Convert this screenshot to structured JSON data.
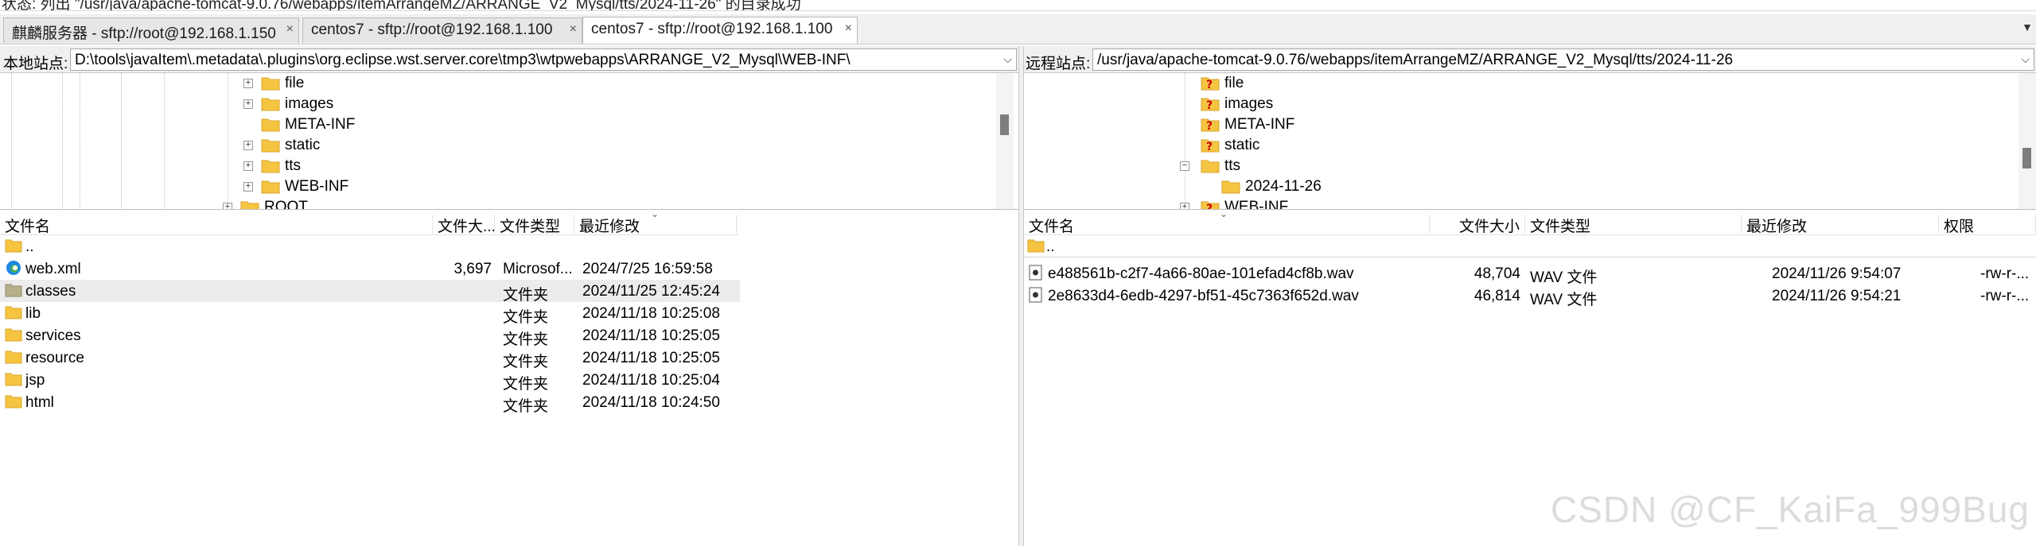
{
  "status_line": "状态: 列出 \"/usr/java/apache-tomcat-9.0.76/webapps/itemArrangeMZ/ARRANGE_V2_Mysql/tts/2024-11-26\" 的目录成功",
  "tabs": [
    {
      "label": "麒麟服务器 - sftp://root@192.168.1.150"
    },
    {
      "label": "centos7 - sftp://root@192.168.1.100"
    },
    {
      "label": "centos7 - sftp://root@192.168.1.100"
    }
  ],
  "local_site": {
    "label": "本地站点:",
    "path": "D:\\tools\\javaItem\\.metadata\\.plugins\\org.eclipse.wst.server.core\\tmp3\\wtpwebapps\\ARRANGE_V2_Mysql\\WEB-INF\\"
  },
  "remote_site": {
    "label": "远程站点:",
    "path": "/usr/java/apache-tomcat-9.0.76/webapps/itemArrangeMZ/ARRANGE_V2_Mysql/tts/2024-11-26"
  },
  "local_tree": [
    {
      "name": "file",
      "expandable": true
    },
    {
      "name": "images",
      "expandable": true
    },
    {
      "name": "META-INF",
      "expandable": false
    },
    {
      "name": "static",
      "expandable": true
    },
    {
      "name": "tts",
      "expandable": true
    },
    {
      "name": "WEB-INF",
      "expandable": true
    },
    {
      "name": "ROOT",
      "expandable": true
    }
  ],
  "remote_tree": [
    {
      "name": "file",
      "unknown": true
    },
    {
      "name": "images",
      "unknown": true
    },
    {
      "name": "META-INF",
      "unknown": true
    },
    {
      "name": "static",
      "unknown": true
    },
    {
      "name": "tts",
      "unknown": false
    },
    {
      "name": "2024-11-26",
      "unknown": false
    },
    {
      "name": "WEB-INF",
      "unknown": true
    }
  ],
  "local_list": {
    "columns": [
      "文件名",
      "文件大...",
      "文件类型",
      "最近修改"
    ],
    "rows": [
      {
        "name": "..",
        "size": "",
        "type": "",
        "modified": "",
        "icon": "folder-up"
      },
      {
        "name": "web.xml",
        "size": "3,697",
        "type": "Microsof...",
        "modified": "2024/7/25 16:59:58",
        "icon": "edge-icon"
      },
      {
        "name": "classes",
        "size": "",
        "type": "文件夹",
        "modified": "2024/11/25 12:45:24",
        "icon": "folder-dark"
      },
      {
        "name": "lib",
        "size": "",
        "type": "文件夹",
        "modified": "2024/11/18 10:25:08",
        "icon": "folder"
      },
      {
        "name": "services",
        "size": "",
        "type": "文件夹",
        "modified": "2024/11/18 10:25:05",
        "icon": "folder"
      },
      {
        "name": "resource",
        "size": "",
        "type": "文件夹",
        "modified": "2024/11/18 10:25:05",
        "icon": "folder"
      },
      {
        "name": "jsp",
        "size": "",
        "type": "文件夹",
        "modified": "2024/11/18 10:25:04",
        "icon": "folder"
      },
      {
        "name": "html",
        "size": "",
        "type": "文件夹",
        "modified": "2024/11/18 10:24:50",
        "icon": "folder"
      }
    ]
  },
  "remote_list": {
    "columns": [
      "文件名",
      "文件大小",
      "文件类型",
      "最近修改",
      "权限"
    ],
    "rows": [
      {
        "name": "..",
        "size": "",
        "type": "",
        "modified": "",
        "perm": "",
        "icon": "folder-up"
      },
      {
        "name": "e488561b-c2f7-4a66-80ae-101efad4cf8b.wav",
        "size": "48,704",
        "type": "WAV 文件",
        "modified": "2024/11/26 9:54:07",
        "perm": "-rw-r-...",
        "icon": "audio-file-icon"
      },
      {
        "name": "2e8633d4-6edb-4297-bf51-45c7363f652d.wav",
        "size": "46,814",
        "type": "WAV 文件",
        "modified": "2024/11/26 9:54:21",
        "perm": "-rw-r-...",
        "icon": "audio-file-icon"
      }
    ]
  },
  "watermark": "CSDN @CF_KaiFa_999Bug",
  "colors": {
    "folder": "#f5c542",
    "folder_dark": "#b8b08a",
    "unknown": "#cc0000",
    "selected_row": "#ececec"
  }
}
